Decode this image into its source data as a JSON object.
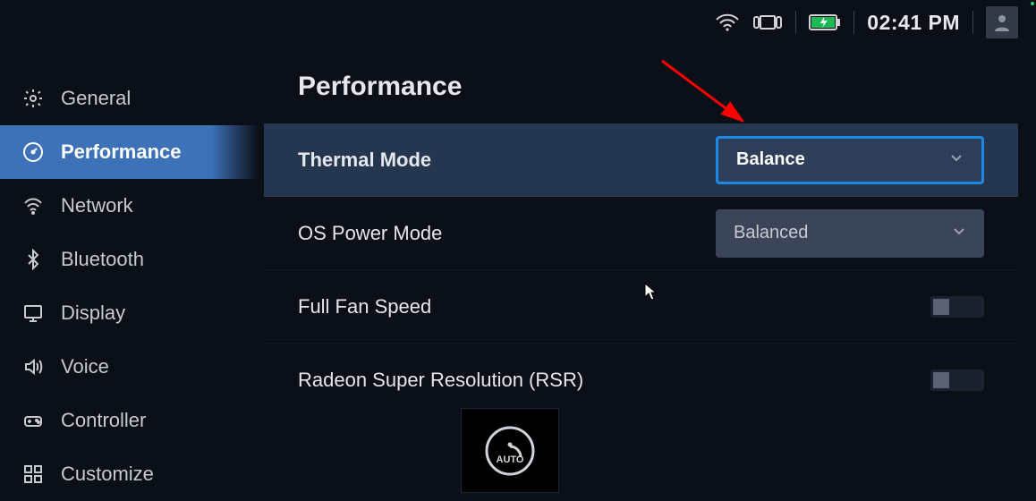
{
  "statusbar": {
    "clock": "02:41 PM"
  },
  "sidebar": {
    "items": [
      {
        "label": "General"
      },
      {
        "label": "Performance"
      },
      {
        "label": "Network"
      },
      {
        "label": "Bluetooth"
      },
      {
        "label": "Display"
      },
      {
        "label": "Voice"
      },
      {
        "label": "Controller"
      },
      {
        "label": "Customize"
      }
    ]
  },
  "page": {
    "title": "Performance"
  },
  "settings": {
    "thermal_mode": {
      "label": "Thermal Mode",
      "value": "Balance"
    },
    "os_power_mode": {
      "label": "OS Power Mode",
      "value": "Balanced"
    },
    "full_fan_speed": {
      "label": "Full Fan Speed"
    },
    "rsr": {
      "label": "Radeon Super Resolution (RSR)"
    }
  },
  "badge": {
    "auto": "AUTO"
  }
}
